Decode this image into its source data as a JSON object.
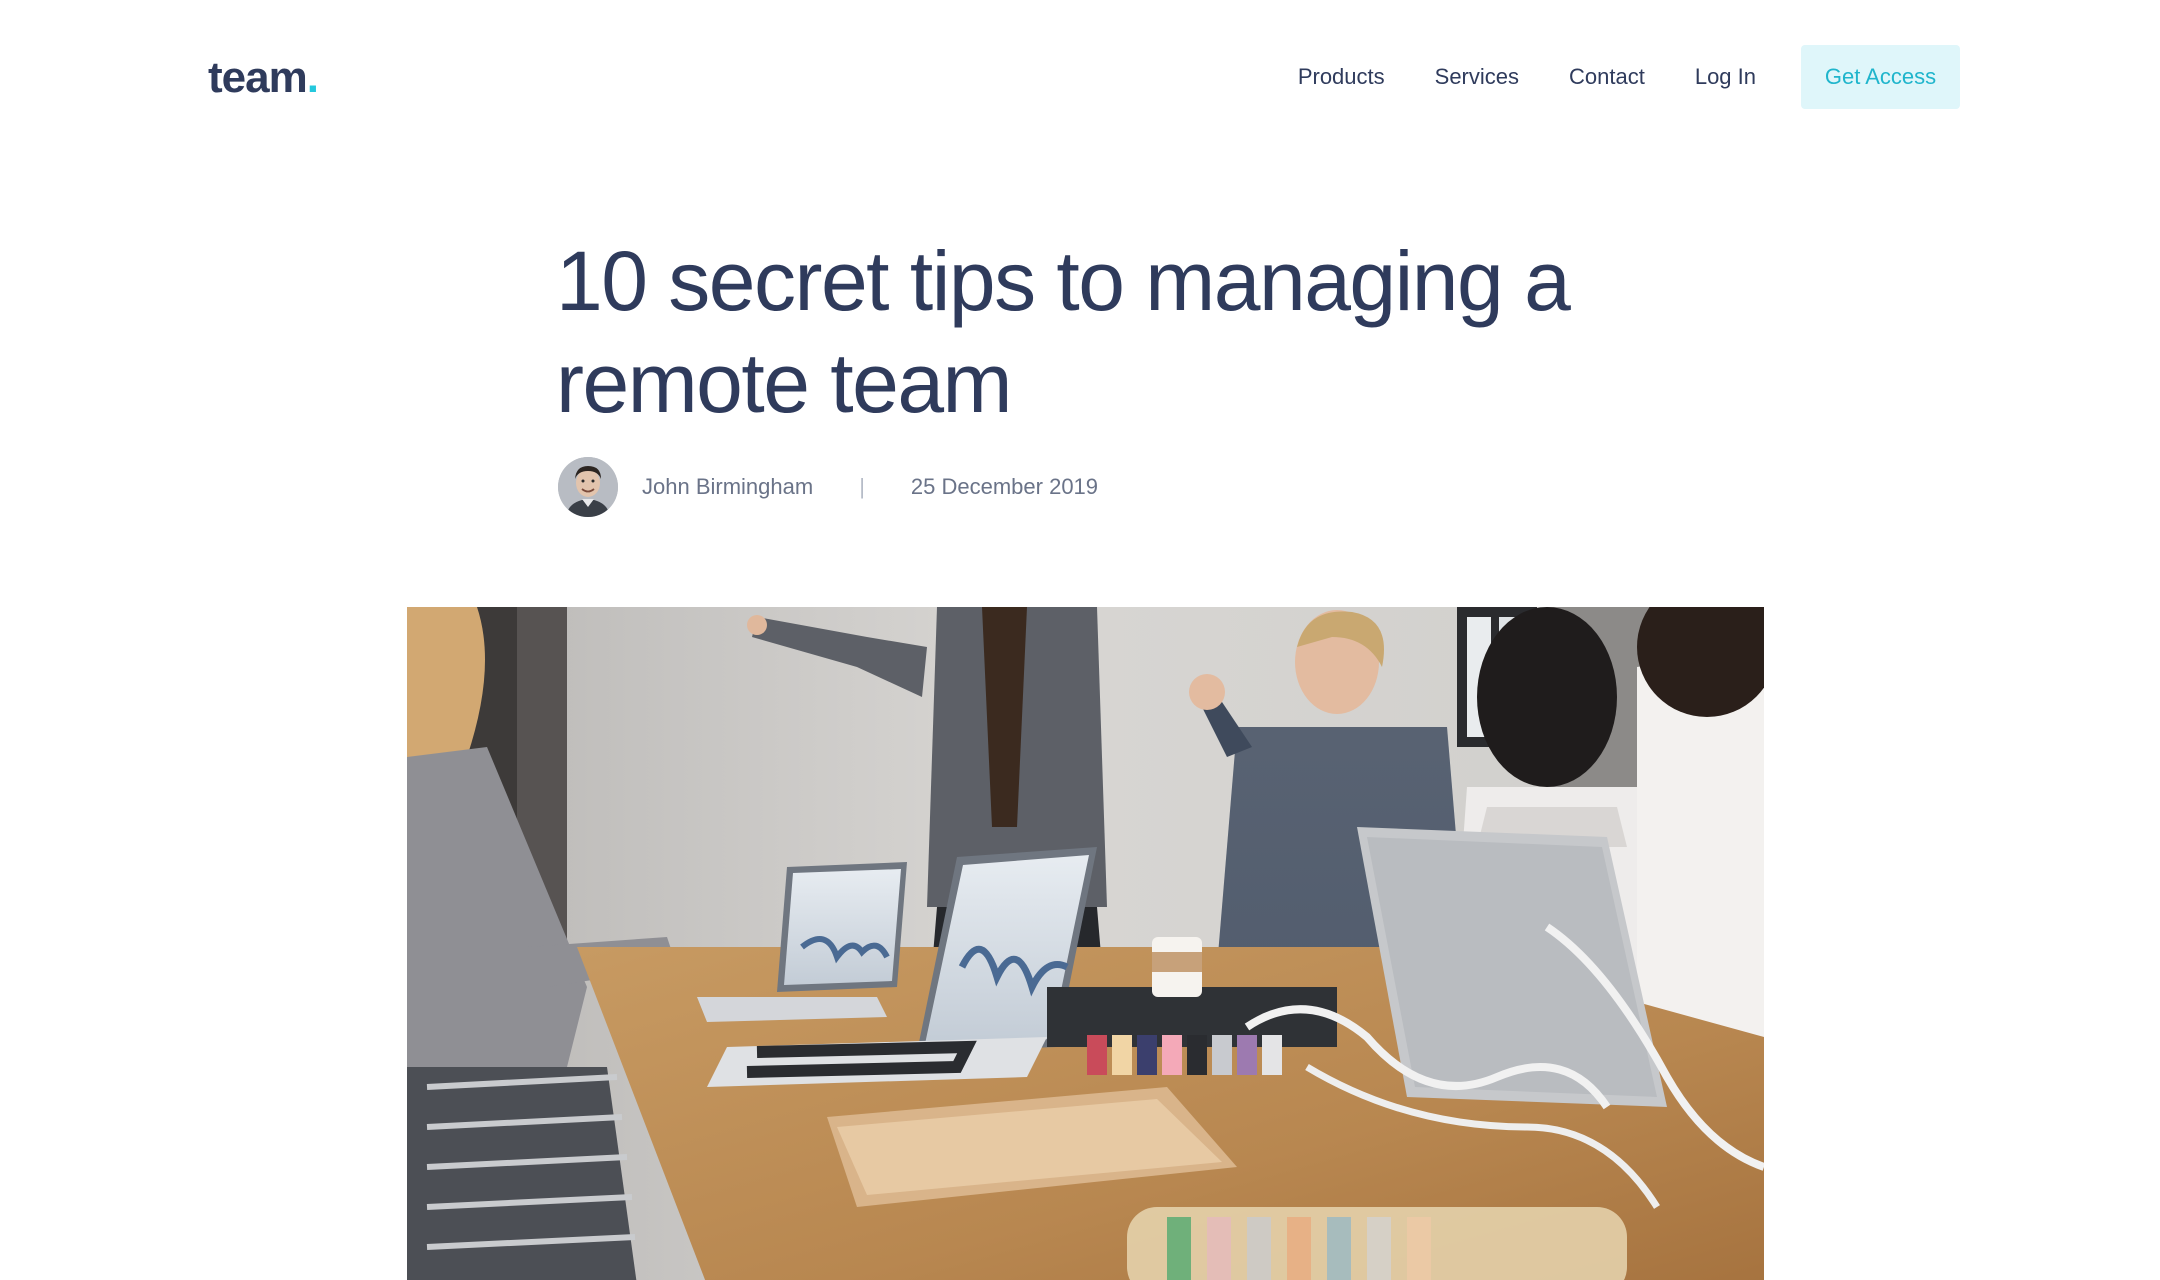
{
  "header": {
    "logo_text": "team",
    "logo_dot": ".",
    "nav": [
      {
        "label": "Products"
      },
      {
        "label": "Services"
      },
      {
        "label": "Contact"
      },
      {
        "label": "Log In"
      }
    ],
    "cta_label": "Get Access"
  },
  "article": {
    "title": "10 secret tips to managing a remote team",
    "author": "John Birmingham",
    "separator": "|",
    "date": "25 December 2019"
  },
  "colors": {
    "text_dark": "#2f3b5c",
    "accent": "#24c8dd",
    "cta_background": "#dff6fa",
    "meta_text": "#6a7388"
  },
  "icons": {
    "avatar": "author-avatar-photo",
    "hero": "team-meeting-photo"
  }
}
